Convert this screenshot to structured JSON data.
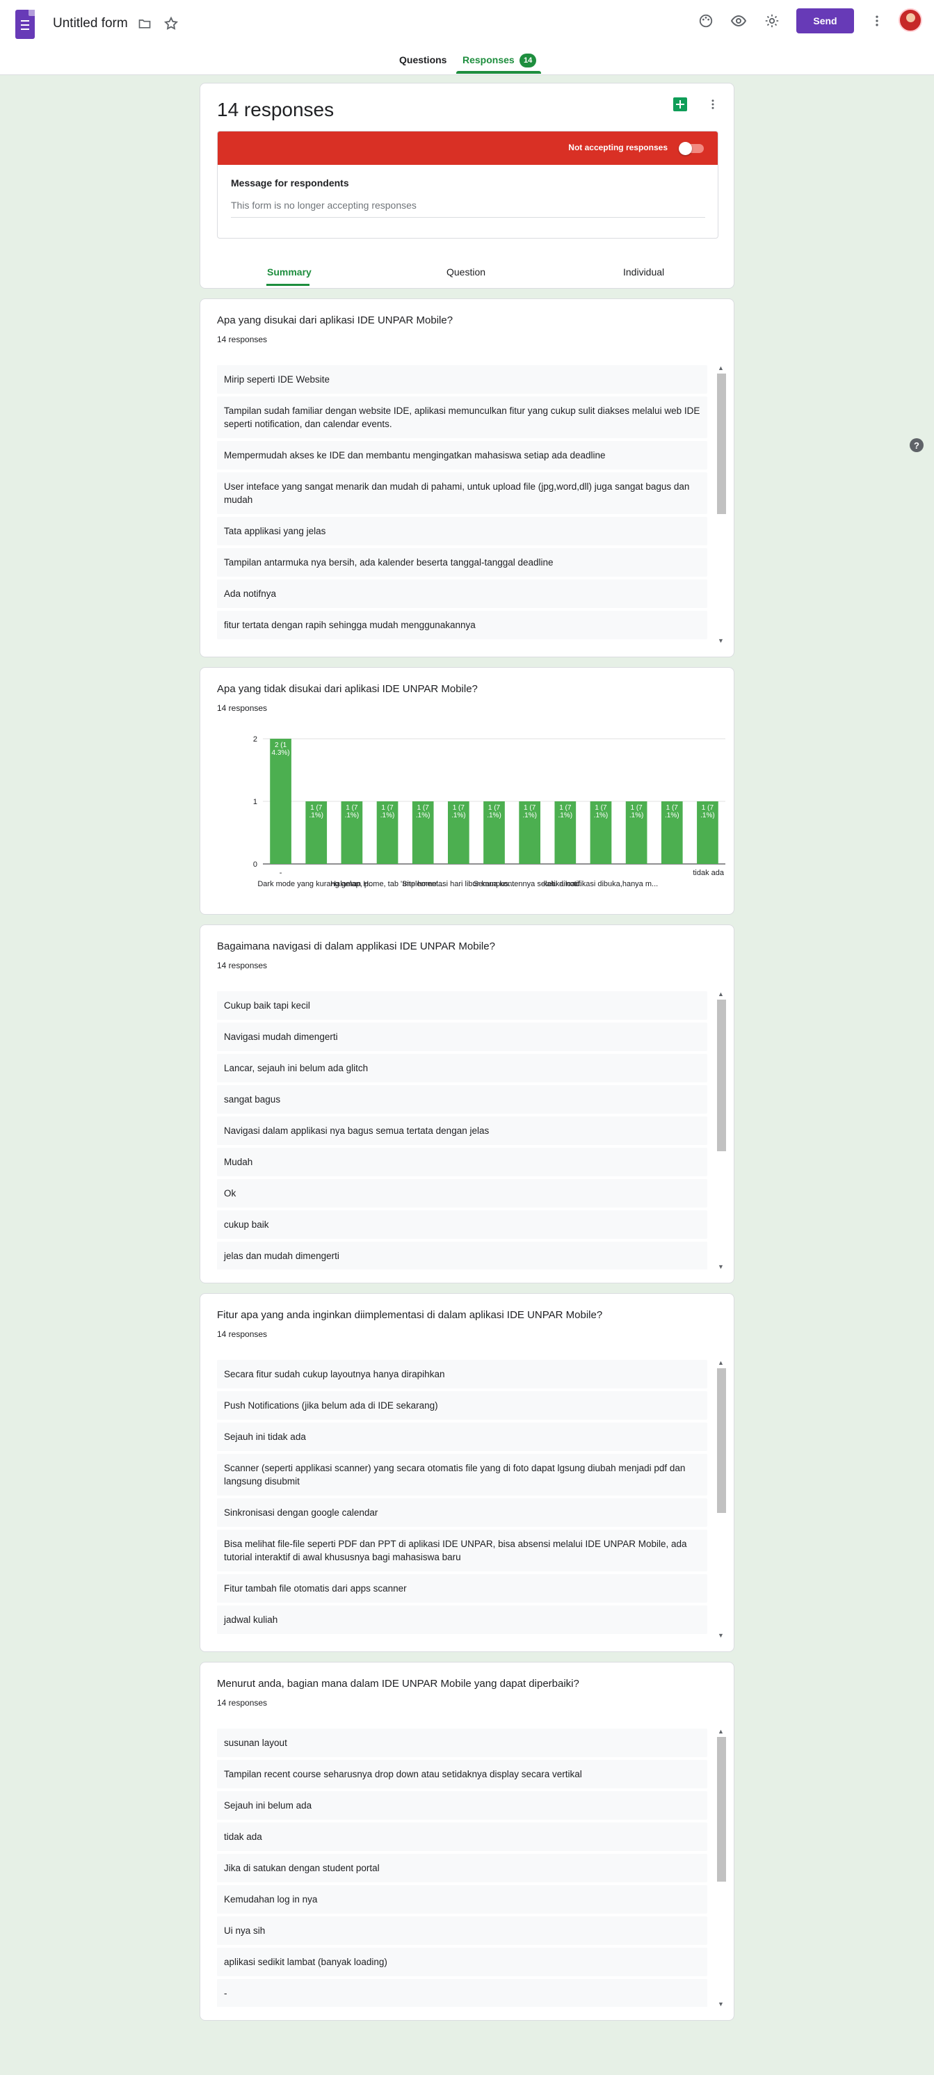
{
  "header": {
    "title": "Untitled form",
    "send_label": "Send",
    "icons": [
      "forms-doc-icon",
      "folder-icon",
      "star-icon",
      "palette-icon",
      "eye-icon",
      "gear-icon",
      "more-vert-icon"
    ]
  },
  "tabs": [
    {
      "label": "Questions",
      "active": false
    },
    {
      "label": "Responses",
      "active": true,
      "badge": "14"
    }
  ],
  "summary": {
    "title": "14 responses",
    "accepting_label": "Not accepting responses",
    "accepting": false,
    "message_label": "Message for respondents",
    "message_value": "This form is no longer accepting responses",
    "sub_tabs": [
      "Summary",
      "Question",
      "Individual"
    ],
    "active_sub_tab": "Summary"
  },
  "questions": [
    {
      "title": "Apa yang disukai dari aplikasi IDE UNPAR Mobile?",
      "count": "14 responses",
      "answers": [
        "Mirip seperti IDE Website",
        "Tampilan sudah familiar dengan website IDE, aplikasi memunculkan fitur yang cukup sulit diakses melalui web IDE seperti notification, dan calendar events.",
        "Mempermudah akses ke IDE dan membantu mengingatkan mahasiswa setiap ada deadline",
        "User inteface yang sangat menarik dan mudah di pahami, untuk upload file (jpg,word,dll) juga sangat bagus dan mudah",
        "Tata applikasi yang jelas",
        "Tampilan antarmuka nya bersih, ada kalender beserta tanggal-tanggal deadline",
        "Ada notifnya",
        "fitur tertata dengan rapih sehingga mudah menggunakannya"
      ]
    },
    {
      "title": "Apa yang tidak disukai dari aplikasi IDE UNPAR Mobile?",
      "count": "14 responses"
    },
    {
      "title": "Bagaimana navigasi di dalam applikasi IDE UNPAR Mobile?",
      "count": "14 responses",
      "answers": [
        "Cukup baik tapi kecil",
        "Navigasi mudah dimengerti",
        "Lancar, sejauh ini belum ada glitch",
        "sangat bagus",
        "Navigasi dalam applikasi nya bagus semua tertata dengan jelas",
        "Mudah",
        "Ok",
        "cukup baik",
        "jelas dan mudah dimengerti"
      ]
    },
    {
      "title": "Fitur apa yang anda inginkan diimplementasi di dalam aplikasi IDE UNPAR Mobile?",
      "count": "14 responses",
      "answers": [
        "Secara fitur sudah cukup layoutnya hanya dirapihkan",
        "Push Notifications (jika belum ada di IDE sekarang)",
        "Sejauh ini tidak ada",
        "Scanner (seperti applikasi scanner) yang secara otomatis file yang di foto dapat lgsung diubah menjadi pdf dan langsung disubmit",
        "Sinkronisasi dengan google calendar",
        "Bisa melihat file-file seperti PDF dan PPT di aplikasi IDE UNPAR, bisa absensi melalui IDE UNPAR Mobile, ada tutorial interaktif di awal khususnya bagi mahasiswa baru",
        "Fitur tambah file otomatis dari apps scanner",
        "jadwal kuliah"
      ]
    },
    {
      "title": "Menurut anda, bagian mana dalam IDE UNPAR Mobile yang dapat diperbaiki?",
      "count": "14 responses",
      "answers": [
        "susunan layout",
        "Tampilan recent course seharusnya drop down atau setidaknya display secara vertikal",
        "Sejauh ini belum ada",
        "tidak ada",
        "Jika di satukan dengan student portal",
        "Kemudahan log in nya",
        "Ui nya sih",
        "aplikasi sedikit lambat (banyak loading)",
        "-"
      ]
    }
  ],
  "chart_data": {
    "type": "bar",
    "title": "",
    "xlabel": "",
    "ylabel": "",
    "ylim": [
      0,
      2
    ],
    "yticks": [
      0,
      1,
      2
    ],
    "color": "#4caf50",
    "categories": [
      "-",
      "Dark mode yang kurang gelap, p...",
      "",
      "Halaman Home, tab 'Site home'...",
      "",
      "Implementasi hari libur kampus...",
      "",
      "Semua kontennya selalu diload...",
      "",
      "ketika notifikasi dibuka,hanya m...",
      "",
      "",
      "tidak ada"
    ],
    "values": [
      2,
      1,
      1,
      1,
      1,
      1,
      1,
      1,
      1,
      1,
      1,
      1,
      1
    ],
    "data_labels": [
      "2 (14.3%)",
      "1 (7.1%)",
      "1 (7.1%)",
      "1 (7.1%)",
      "1 (7.1%)",
      "1 (7.1%)",
      "1 (7.1%)",
      "1 (7.1%)",
      "1 (7.1%)",
      "1 (7.1%)",
      "1 (7.1%)",
      "1 (7.1%)",
      "1 (7.1%)"
    ]
  }
}
